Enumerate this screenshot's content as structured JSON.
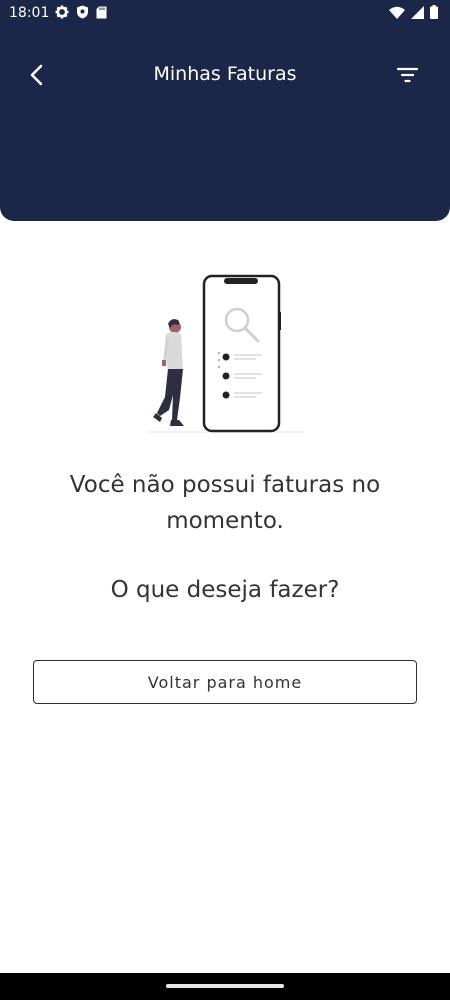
{
  "status_bar": {
    "time": "18:01",
    "left_icons": [
      "settings-icon",
      "shield-icon",
      "sd-card-icon"
    ],
    "right_icons": [
      "wifi-icon",
      "signal-icon",
      "battery-icon"
    ]
  },
  "header": {
    "title": "Minhas Faturas",
    "back_icon": "chevron-left-icon",
    "filter_icon": "filter-icon",
    "background_color": "#1b2749"
  },
  "empty_state": {
    "illustration": "person-with-phone-search-illustration",
    "message": "Você não possui faturas no momento.",
    "question": "O que deseja fazer?",
    "button_label": "Voltar para home"
  }
}
